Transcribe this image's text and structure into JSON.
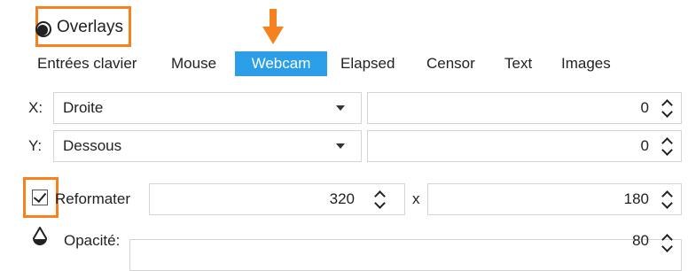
{
  "header": {
    "title": "Overlays",
    "icon": "overlays-toggle-icon"
  },
  "tabs": [
    {
      "label": "Entrées clavier"
    },
    {
      "label": "Mouse"
    },
    {
      "label": "Webcam"
    },
    {
      "label": "Elapsed"
    },
    {
      "label": "Censor"
    },
    {
      "label": "Text"
    },
    {
      "label": "Images"
    }
  ],
  "active_tab": "Webcam",
  "x_row": {
    "label": "X:",
    "value": "Droite",
    "offset": "0"
  },
  "y_row": {
    "label": "Y:",
    "value": "Dessous",
    "offset": "0"
  },
  "resize": {
    "label": "Reformater",
    "checked": true,
    "width": "320",
    "separator": "x",
    "height": "180"
  },
  "opacity": {
    "label": "Opacité:",
    "value": "80",
    "icon": "opacity-drop-icon"
  },
  "colors": {
    "accent": "#2a9fe8",
    "highlight": "#f5821f"
  }
}
